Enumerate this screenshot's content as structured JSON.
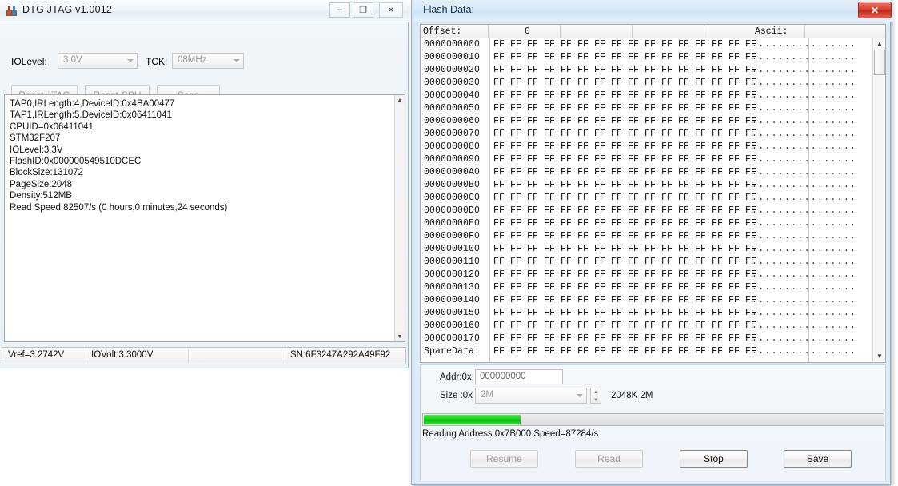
{
  "main_window": {
    "title": "DTG JTAG v1.0012",
    "icon": "app-icon",
    "titlebar_buttons": [
      {
        "name": "minimize",
        "glyph": "–"
      },
      {
        "name": "maximize",
        "glyph": "❐"
      },
      {
        "name": "close",
        "glyph": "✕"
      }
    ],
    "toolbar": {
      "iolevel_label": "IOLevel:",
      "iolevel_value": "3.0V",
      "tck_label": "TCK:",
      "tck_value": "08MHz",
      "reset_jtag_label": "Reset JTAG",
      "reset_cpu_label": "Reset CPU",
      "scan_label": "Scan"
    },
    "log": "TAP0,IRLength:4,DeviceID:0x4BA00477\nTAP1,IRLength:5,DeviceID:0x06411041\nCPUID=0x06411041\nSTM32F207\nIOLevel:3.3V\nFlashID:0x000000549510DCEC\nBlockSize:131072\nPageSize:2048\nDensity:512MB\nRead Speed:82507/s (0 hours,0 minutes,24 seconds)",
    "statusbar": {
      "vref": "Vref=3.2742V",
      "iovolt": "IOVolt:3.3000V",
      "sn": "SN:6F3247A292A49F92"
    }
  },
  "flash_window": {
    "title": "Flash Data:",
    "close_glyph": "✕",
    "hex_header": {
      "offset_label": "Offset:",
      "column_zero": "0",
      "ascii_label": "Ascii:"
    },
    "hex_rows": [
      {
        "offset": "0000000000",
        "bytes": "FF FF FF FF FF FF FF FF FF FF FF FF FF FF FF FF",
        "ascii": "................"
      },
      {
        "offset": "0000000010",
        "bytes": "FF FF FF FF FF FF FF FF FF FF FF FF FF FF FF FF",
        "ascii": "................"
      },
      {
        "offset": "0000000020",
        "bytes": "FF FF FF FF FF FF FF FF FF FF FF FF FF FF FF FF",
        "ascii": "................"
      },
      {
        "offset": "0000000030",
        "bytes": "FF FF FF FF FF FF FF FF FF FF FF FF FF FF FF FF",
        "ascii": "................"
      },
      {
        "offset": "0000000040",
        "bytes": "FF FF FF FF FF FF FF FF FF FF FF FF FF FF FF FF",
        "ascii": "................"
      },
      {
        "offset": "0000000050",
        "bytes": "FF FF FF FF FF FF FF FF FF FF FF FF FF FF FF FF",
        "ascii": "................"
      },
      {
        "offset": "0000000060",
        "bytes": "FF FF FF FF FF FF FF FF FF FF FF FF FF FF FF FF",
        "ascii": "................"
      },
      {
        "offset": "0000000070",
        "bytes": "FF FF FF FF FF FF FF FF FF FF FF FF FF FF FF FF",
        "ascii": "................"
      },
      {
        "offset": "0000000080",
        "bytes": "FF FF FF FF FF FF FF FF FF FF FF FF FF FF FF FF",
        "ascii": "................"
      },
      {
        "offset": "0000000090",
        "bytes": "FF FF FF FF FF FF FF FF FF FF FF FF FF FF FF FF",
        "ascii": "................"
      },
      {
        "offset": "00000000A0",
        "bytes": "FF FF FF FF FF FF FF FF FF FF FF FF FF FF FF FF",
        "ascii": "................"
      },
      {
        "offset": "00000000B0",
        "bytes": "FF FF FF FF FF FF FF FF FF FF FF FF FF FF FF FF",
        "ascii": "................"
      },
      {
        "offset": "00000000C0",
        "bytes": "FF FF FF FF FF FF FF FF FF FF FF FF FF FF FF FF",
        "ascii": "................"
      },
      {
        "offset": "00000000D0",
        "bytes": "FF FF FF FF FF FF FF FF FF FF FF FF FF FF FF FF",
        "ascii": "................"
      },
      {
        "offset": "00000000E0",
        "bytes": "FF FF FF FF FF FF FF FF FF FF FF FF FF FF FF FF",
        "ascii": "................"
      },
      {
        "offset": "00000000F0",
        "bytes": "FF FF FF FF FF FF FF FF FF FF FF FF FF FF FF FF",
        "ascii": "................"
      },
      {
        "offset": "0000000100",
        "bytes": "FF FF FF FF FF FF FF FF FF FF FF FF FF FF FF FF",
        "ascii": "................"
      },
      {
        "offset": "0000000110",
        "bytes": "FF FF FF FF FF FF FF FF FF FF FF FF FF FF FF FF",
        "ascii": "................"
      },
      {
        "offset": "0000000120",
        "bytes": "FF FF FF FF FF FF FF FF FF FF FF FF FF FF FF FF",
        "ascii": "................"
      },
      {
        "offset": "0000000130",
        "bytes": "FF FF FF FF FF FF FF FF FF FF FF FF FF FF FF FF",
        "ascii": "................"
      },
      {
        "offset": "0000000140",
        "bytes": "FF FF FF FF FF FF FF FF FF FF FF FF FF FF FF FF",
        "ascii": "................"
      },
      {
        "offset": "0000000150",
        "bytes": "FF FF FF FF FF FF FF FF FF FF FF FF FF FF FF FF",
        "ascii": "................"
      },
      {
        "offset": "0000000160",
        "bytes": "FF FF FF FF FF FF FF FF FF FF FF FF FF FF FF FF",
        "ascii": "................"
      },
      {
        "offset": "0000000170",
        "bytes": "FF FF FF FF FF FF FF FF FF FF FF FF FF FF FF FF",
        "ascii": "................"
      },
      {
        "offset": "SpareData:",
        "bytes": "FF FF FF FF FF FF FF FF FF FF FF FF FF FF FF FF",
        "ascii": "................"
      }
    ],
    "controls": {
      "addr_label": "Addr:0x",
      "addr_value": "000000000",
      "size_label": "Size :0x",
      "size_value": "2M",
      "size_note": "2048K  2M",
      "progress_percent": 21,
      "progress_status": "Reading Address 0x7B000 Speed=87284/s",
      "buttons": [
        {
          "name": "resume",
          "label": "Resume",
          "enabled": false
        },
        {
          "name": "read",
          "label": "Read",
          "enabled": false
        },
        {
          "name": "stop",
          "label": "Stop",
          "enabled": true
        },
        {
          "name": "save",
          "label": "Save",
          "enabled": true
        }
      ]
    }
  },
  "colors": {
    "progress_green": "#17cf17",
    "close_red": "#c32a1c",
    "flash_frame_blue": "#8fb3d0"
  }
}
